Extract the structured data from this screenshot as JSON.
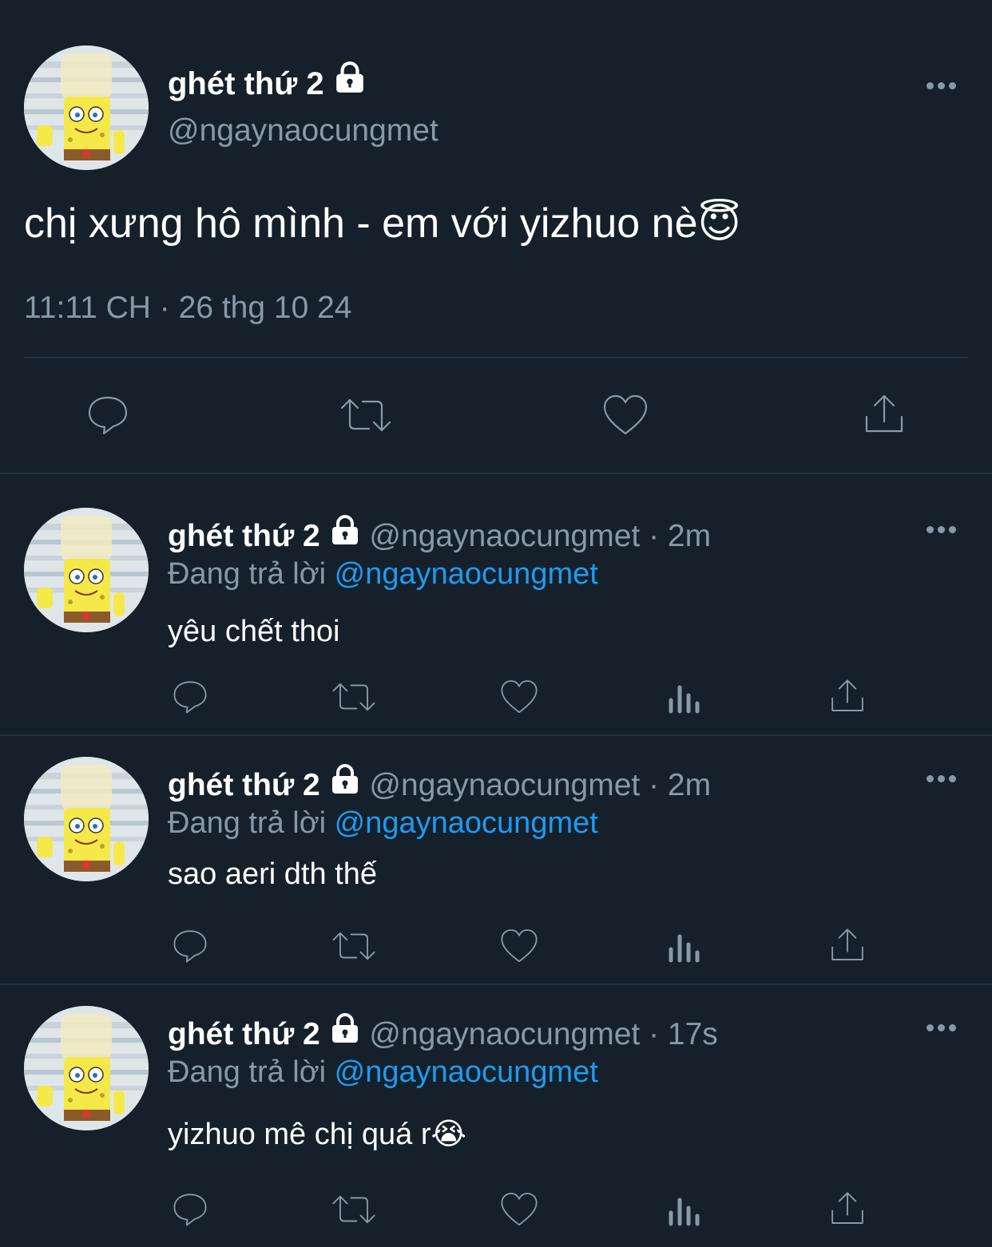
{
  "main_tweet": {
    "display_name": "ghét thứ 2",
    "handle": "@ngaynaocungmet",
    "text": "chị xưng hô mình - em với yizhuo nè😇",
    "timestamp": "11:11 CH · 26 thg 10 24",
    "actions": [
      "reply-icon",
      "retweet-icon",
      "like-icon",
      "share-icon"
    ]
  },
  "replies": [
    {
      "display_name": "ghét thứ 2",
      "handle": "@ngaynaocungmet",
      "separator": " · ",
      "time": "2m",
      "replying_label": "Đang trả lời",
      "replying_to": "@ngaynaocungmet",
      "text": "yêu chết thoi"
    },
    {
      "display_name": "ghét thứ 2",
      "handle": "@ngaynaocungmet",
      "separator": " · ",
      "time": "2m",
      "replying_label": "Đang trả lời",
      "replying_to": "@ngaynaocungmet",
      "text": "sao aeri dth thế"
    },
    {
      "display_name": "ghét thứ 2",
      "handle": "@ngaynaocungmet",
      "separator": " · ",
      "time": "17s",
      "replying_label": "Đang trả lời",
      "replying_to": "@ngaynaocungmet",
      "text": "yizhuo mê chị quá r😭"
    }
  ],
  "colors": {
    "background": "#15202b",
    "muted_text": "#8899a6",
    "link": "#1d9bf0",
    "divider": "#253341"
  }
}
